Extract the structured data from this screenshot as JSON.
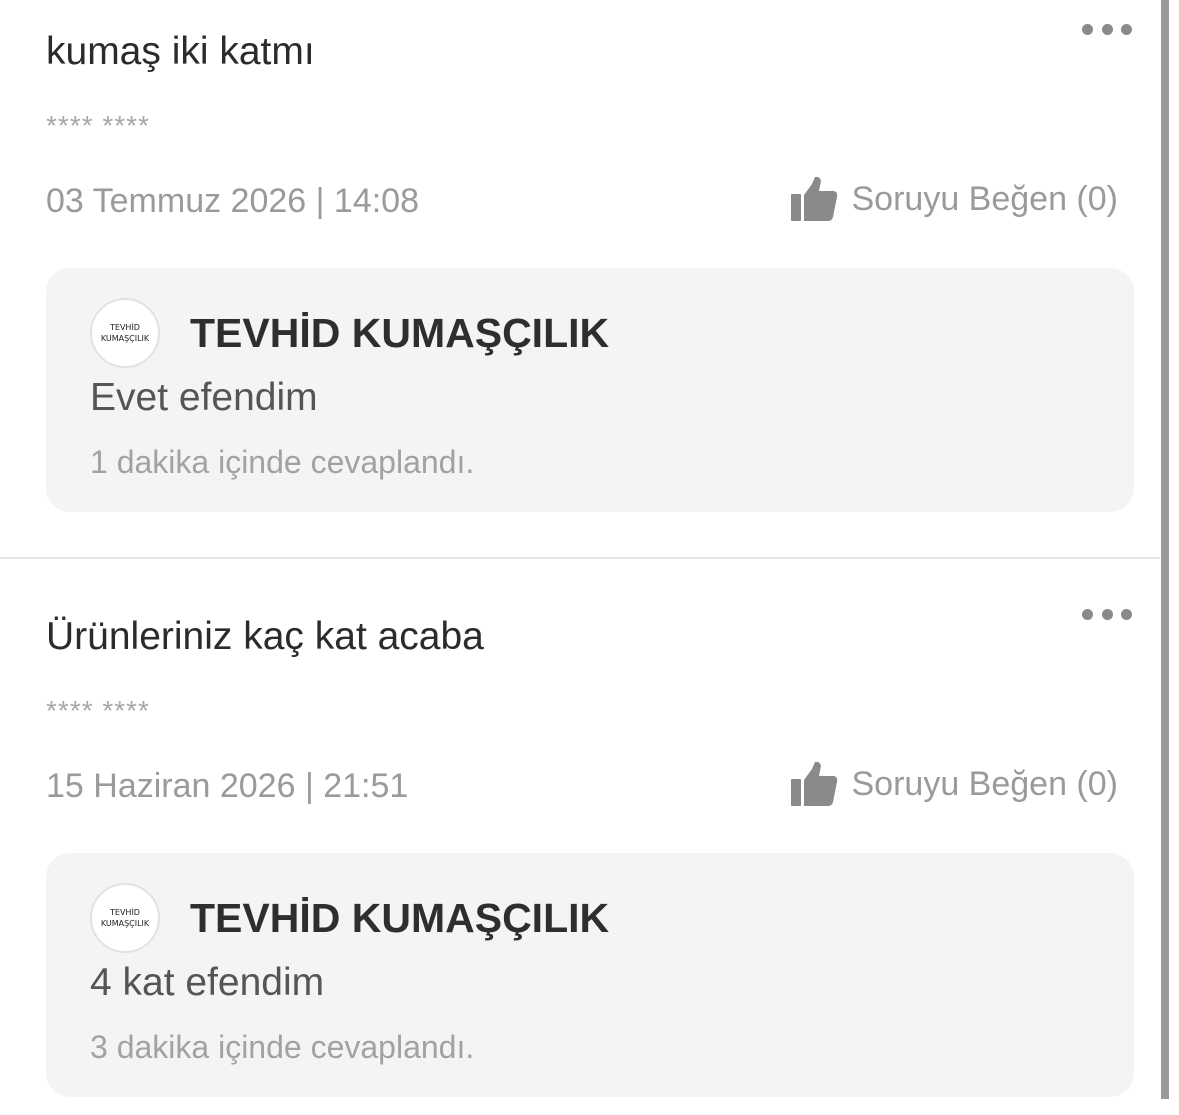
{
  "questions": [
    {
      "text": "kumaş iki katmı",
      "author": "**** ****",
      "date": "03 Temmuz 2026 | 14:08",
      "like_label": "Soruyu Beğen (0)",
      "answer": {
        "seller_name": "TEVHİD KUMAŞÇILIK",
        "avatar_line1": "TEVHİD",
        "avatar_line2": "KUMAŞÇILIK",
        "text": "Evet efendim",
        "time": "1 dakika içinde cevaplandı."
      }
    },
    {
      "text": "Ürünleriniz kaç kat acaba",
      "author": "**** ****",
      "date": "15 Haziran 2026 | 21:51",
      "like_label": "Soruyu Beğen (0)",
      "answer": {
        "seller_name": "TEVHİD KUMAŞÇILIK",
        "avatar_line1": "TEVHİD",
        "avatar_line2": "KUMAŞÇILIK",
        "text": "4 kat efendim",
        "time": "3 dakika içinde cevaplandı."
      }
    }
  ],
  "icons": {
    "more": "more-dots-icon",
    "like": "thumbs-up-icon"
  },
  "colors": {
    "card_background": "#f4f4f4",
    "muted_text": "#9a9a9a",
    "primary_text": "#2b2b2b",
    "icon_gray": "#8a8a8a"
  }
}
